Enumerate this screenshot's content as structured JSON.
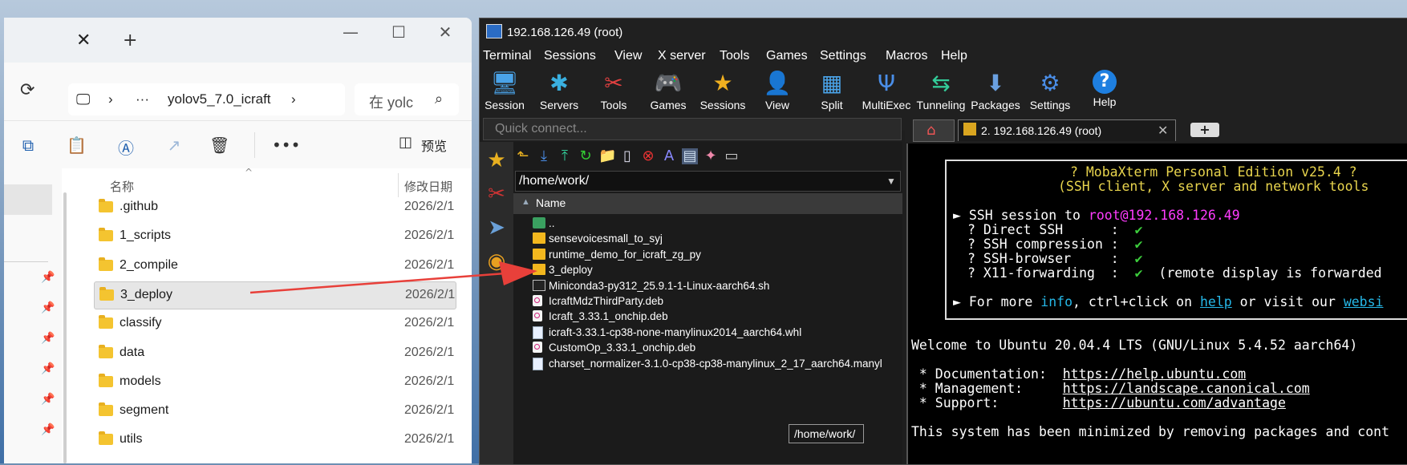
{
  "explorer": {
    "close_tab": "✕",
    "new_tab": "+",
    "path": {
      "dots": "···",
      "folder": "yolov5_7.0_icraft"
    },
    "search_placeholder": "在 yolc",
    "preview_label": "预览",
    "columns": {
      "name": "名称",
      "modified": "修改日期"
    },
    "rows": [
      {
        "name": ".github",
        "date": "2026/2/1",
        "selected": false
      },
      {
        "name": "1_scripts",
        "date": "2026/2/1",
        "selected": false
      },
      {
        "name": "2_compile",
        "date": "2026/2/1",
        "selected": false
      },
      {
        "name": "3_deploy",
        "date": "2026/2/1",
        "selected": true
      },
      {
        "name": "classify",
        "date": "2026/2/1",
        "selected": false
      },
      {
        "name": "data",
        "date": "2026/2/1",
        "selected": false
      },
      {
        "name": "models",
        "date": "2026/2/1",
        "selected": false
      },
      {
        "name": "segment",
        "date": "2026/2/1",
        "selected": false
      },
      {
        "name": "utils",
        "date": "2026/2/1",
        "selected": false
      }
    ]
  },
  "moba": {
    "title": "192.168.126.49 (root)",
    "menu": [
      "Terminal",
      "Sessions",
      "View",
      "X server",
      "Tools",
      "Games",
      "Settings",
      "Macros",
      "Help"
    ],
    "tools": [
      {
        "label": "Session",
        "icon": "monitor-icon",
        "glyph": "🖥",
        "color": "#4aa3e8"
      },
      {
        "label": "Servers",
        "icon": "servers-icon",
        "glyph": "✱",
        "color": "#3ab0e0"
      },
      {
        "label": "Tools",
        "icon": "tools-icon",
        "glyph": "✂",
        "color": "#e04040"
      },
      {
        "label": "Games",
        "icon": "gamepad-icon",
        "glyph": "🎮",
        "color": "#ddd"
      },
      {
        "label": "Sessions",
        "icon": "star-icon",
        "glyph": "★",
        "color": "#f0b020"
      },
      {
        "label": "View",
        "icon": "view-icon",
        "glyph": "👤",
        "color": "#7ac"
      },
      {
        "label": "Split",
        "icon": "split-icon",
        "glyph": "▦",
        "color": "#4aa3e8"
      },
      {
        "label": "MultiExec",
        "icon": "fork-icon",
        "glyph": "Ψ",
        "color": "#4a8ee8"
      },
      {
        "label": "Tunneling",
        "icon": "tunnel-icon",
        "glyph": "⇆",
        "color": "#3c9"
      },
      {
        "label": "Packages",
        "icon": "package-icon",
        "glyph": "⬇",
        "color": "#6aa0e0"
      },
      {
        "label": "Settings",
        "icon": "gear-icon",
        "glyph": "⚙",
        "color": "#4a8ee8"
      },
      {
        "label": "Help",
        "icon": "help-icon",
        "glyph": "?",
        "color": "#fff"
      }
    ],
    "quick_connect": "Quick connect...",
    "sftp": {
      "path": "/home/work/",
      "header": "Name",
      "files": [
        {
          "name": "..",
          "type": "up"
        },
        {
          "name": "sensevoicesmall_to_syj",
          "type": "folder"
        },
        {
          "name": "runtime_demo_for_icraft_zg_py",
          "type": "folder"
        },
        {
          "name": "3_deploy",
          "type": "folder"
        },
        {
          "name": "Miniconda3-py312_25.9.1-1-Linux-aarch64.sh",
          "type": "sh"
        },
        {
          "name": "IcraftMdzThirdParty.deb",
          "type": "deb"
        },
        {
          "name": "Icraft_3.33.1_onchip.deb",
          "type": "deb"
        },
        {
          "name": "icraft-3.33.1-cp38-none-manylinux2014_aarch64.whl",
          "type": "whl"
        },
        {
          "name": "CustomOp_3.33.1_onchip.deb",
          "type": "deb"
        },
        {
          "name": "charset_normalizer-3.1.0-cp38-cp38-manylinux_2_17_aarch64.manyl",
          "type": "whl"
        }
      ],
      "tooltip": "/home/work/"
    },
    "tab_label": "2. 192.168.126.49 (root)",
    "tab_close": "✕",
    "terminal": {
      "banner_title": "? MobaXterm Personal Edition v25.4 ?",
      "banner_sub": "(SSH client, X server and network tools",
      "ssh_prefix": "► SSH session to ",
      "ssh_host": "root@192.168.126.49",
      "features": [
        {
          "label": "? Direct SSH      :  ",
          "mark": "✔",
          "extra": ""
        },
        {
          "label": "? SSH compression :  ",
          "mark": "✔",
          "extra": ""
        },
        {
          "label": "? SSH-browser     :  ",
          "mark": "✔",
          "extra": ""
        },
        {
          "label": "? X11-forwarding  :  ",
          "mark": "✔",
          "extra": "  (remote display is forwarded"
        }
      ],
      "more_1": "► For more ",
      "more_info": "info",
      "more_2": ", ctrl+click on ",
      "more_help": "help",
      "more_3": " or visit our ",
      "more_web": "websi",
      "welcome": "Welcome to Ubuntu 20.04.4 LTS (GNU/Linux 5.4.52 aarch64)",
      "doc_label": " * Documentation:  ",
      "doc_url": "https://help.ubuntu.com",
      "mgmt_label": " * Management:     ",
      "mgmt_url": "https://landscape.canonical.com",
      "support_label": " * Support:        ",
      "support_url": "https://ubuntu.com/advantage",
      "last_line": "This system has been minimized by removing packages and cont"
    }
  }
}
